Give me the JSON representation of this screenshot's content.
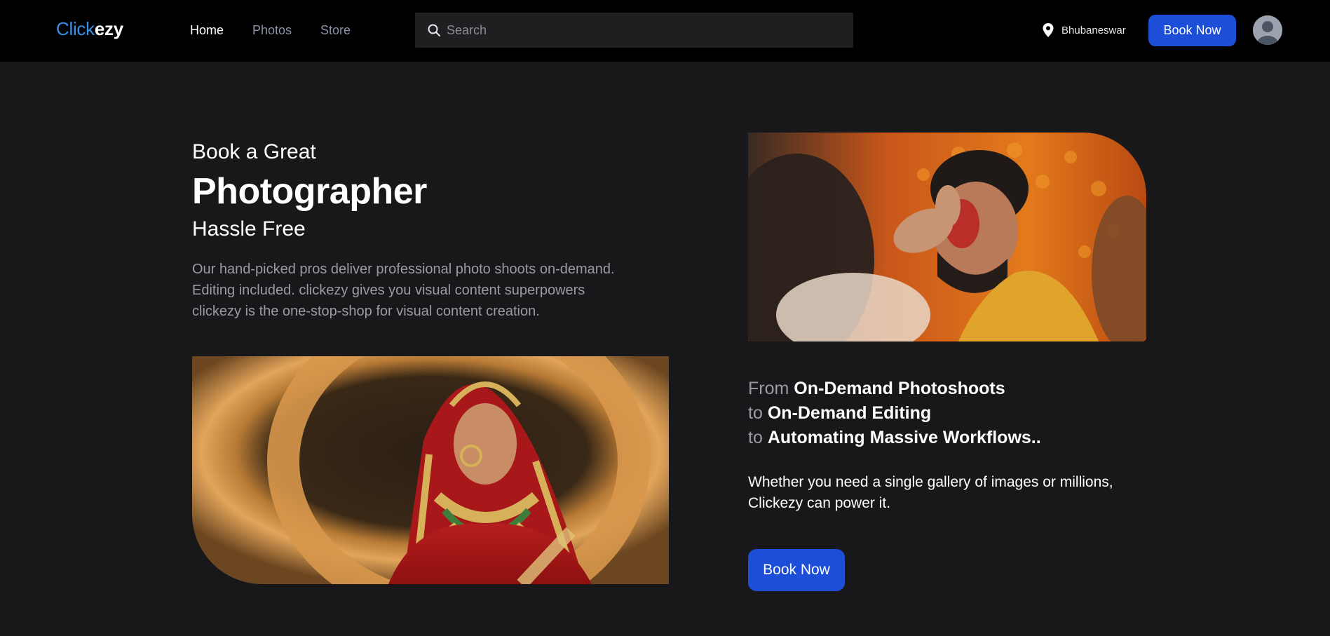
{
  "brand": {
    "part1": "Click",
    "part2": "ezy"
  },
  "nav": {
    "links": [
      {
        "label": "Home",
        "active": true
      },
      {
        "label": "Photos",
        "active": false
      },
      {
        "label": "Store",
        "active": false
      }
    ],
    "search_placeholder": "Search",
    "location": "Bhubaneswar",
    "book_label": "Book Now"
  },
  "hero": {
    "kicker": "Book a Great",
    "headline": "Photographer",
    "sub": "Hassle Free",
    "description_lines": [
      "Our hand-picked pros deliver professional photo shoots on-demand.",
      "Editing included. clickezy gives you visual content superpowers",
      "clickezy is the one-stop-shop for visual content creation."
    ]
  },
  "features": [
    {
      "prefix": "From",
      "text": "On-Demand Photoshoots"
    },
    {
      "prefix": "to",
      "text": "On-Demand Editing"
    },
    {
      "prefix": "to",
      "text": "Automating Massive Workflows.."
    }
  ],
  "power": {
    "line1": "Whether you need a single gallery of images or millions,",
    "line2": "Clickezy can power it."
  },
  "cta_label": "Book Now",
  "colors": {
    "background": "#18181b",
    "navbar": "#000000",
    "accent": "#1d4ed8",
    "logo_blue": "#3b8fe8",
    "muted_text": "#9a9ca3"
  },
  "icons": [
    "search-icon",
    "location-pin-icon",
    "user-avatar-icon"
  ]
}
